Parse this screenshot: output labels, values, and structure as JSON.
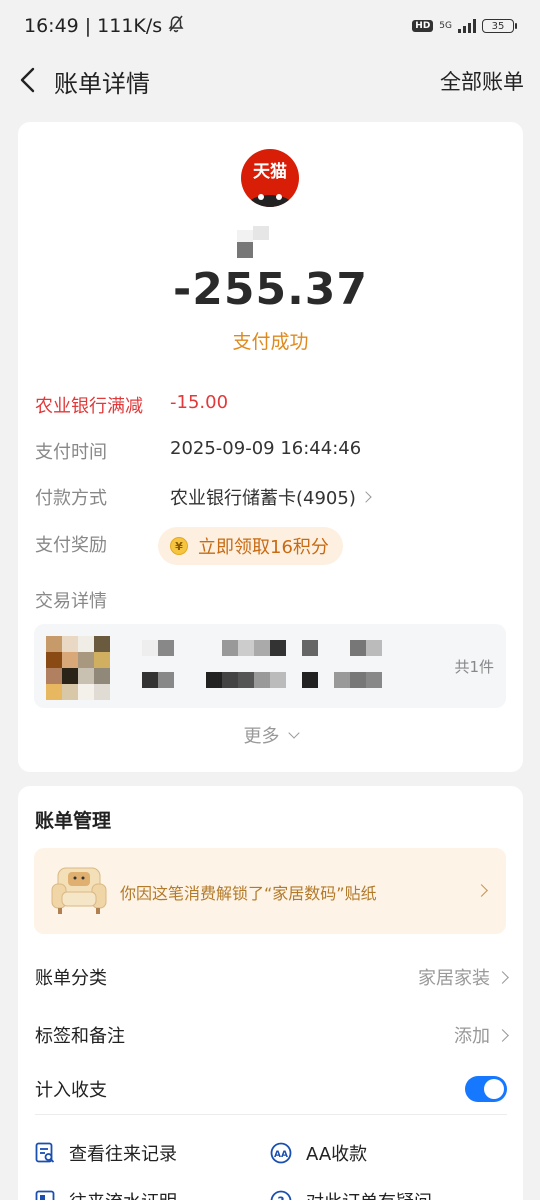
{
  "status_bar": {
    "time": "16:49",
    "net_speed": "111K/s",
    "hd": "HD",
    "network": "5G",
    "battery": "35"
  },
  "nav": {
    "title": "账单详情",
    "right_action": "全部账单"
  },
  "bill": {
    "merchant_logo_text": "天猫",
    "amount": "-255.37",
    "status": "支付成功",
    "discount": {
      "label": "农业银行满减",
      "value": "-15.00"
    },
    "pay_time": {
      "label": "支付时间",
      "value": "2025-09-09 16:44:46"
    },
    "pay_method": {
      "label": "付款方式",
      "value": "农业银行储蓄卡(4905)"
    },
    "reward": {
      "label": "支付奖励",
      "value": "立即领取16积分"
    },
    "trade": {
      "label": "交易详情",
      "count": "共1件"
    },
    "more": "更多"
  },
  "management": {
    "title": "账单管理",
    "sticker_text": "你因这笔消费解锁了“家居数码”贴纸",
    "category": {
      "label": "账单分类",
      "value": "家居家装"
    },
    "tags": {
      "label": "标签和备注",
      "value": "添加"
    },
    "income": {
      "label": "计入收支",
      "enabled": true
    },
    "actions": [
      "查看往来记录",
      "AA收款",
      "往来流水证明",
      "对此订单有疑问"
    ]
  },
  "colors": {
    "accent": "#1677ff",
    "orange": "#e08a1e",
    "red": "#e03a3a",
    "brand_red": "#d81e06"
  }
}
